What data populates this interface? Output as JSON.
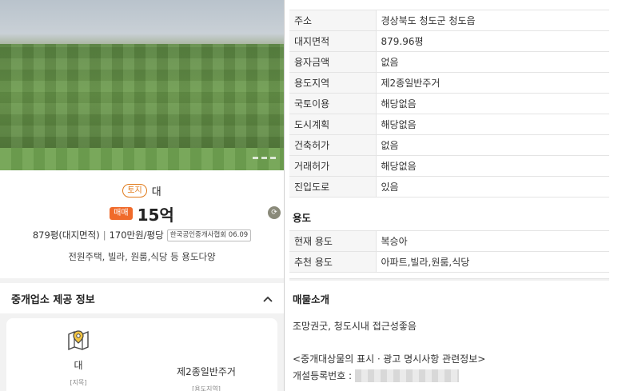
{
  "listing": {
    "type_badge": "토지",
    "type_value": "대",
    "deal_badge": "매매",
    "price": "15억",
    "area": "879평(대지면적)",
    "separator": "|",
    "unit_price": "170만원/평당",
    "source_badge": "한국공인중개사협회 06.09",
    "description": "전원주택, 빌라, 원룸,식당 등 용도다양"
  },
  "agent_section": {
    "title": "중개업소 제공 정보",
    "items": [
      {
        "value": "대",
        "label": "[지목]",
        "icon": "map-pin-icon"
      },
      {
        "value": "제2종일반주거",
        "label": "[용도지역]"
      }
    ]
  },
  "details": [
    {
      "key": "주소",
      "value": "경상북도 청도군 청도읍"
    },
    {
      "key": "대지면적",
      "value": "879.96평"
    },
    {
      "key": "융자금액",
      "value": "없음"
    },
    {
      "key": "용도지역",
      "value": "제2종일반주거"
    },
    {
      "key": "국토이용",
      "value": "해당없음"
    },
    {
      "key": "도시계획",
      "value": "해당없음"
    },
    {
      "key": "건축허가",
      "value": "없음"
    },
    {
      "key": "거래허가",
      "value": "해당없음"
    },
    {
      "key": "진입도로",
      "value": "있음"
    }
  ],
  "usage": {
    "title": "용도",
    "rows": [
      {
        "key": "현재 용도",
        "value": "복승아"
      },
      {
        "key": "추천 용도",
        "value": "아파트,빌라,원룸,식당"
      }
    ]
  },
  "intro": {
    "title": "매물소개",
    "text": "조망권굿, 청도시내 접근성좋음",
    "notice": "<중개대상물의 표시ㆍ광고 명시사항 관련정보>",
    "registration_label": "개설등록번호 :"
  },
  "colors": {
    "accent_orange": "#f06a2a",
    "badge_orange": "#e07a1a"
  }
}
